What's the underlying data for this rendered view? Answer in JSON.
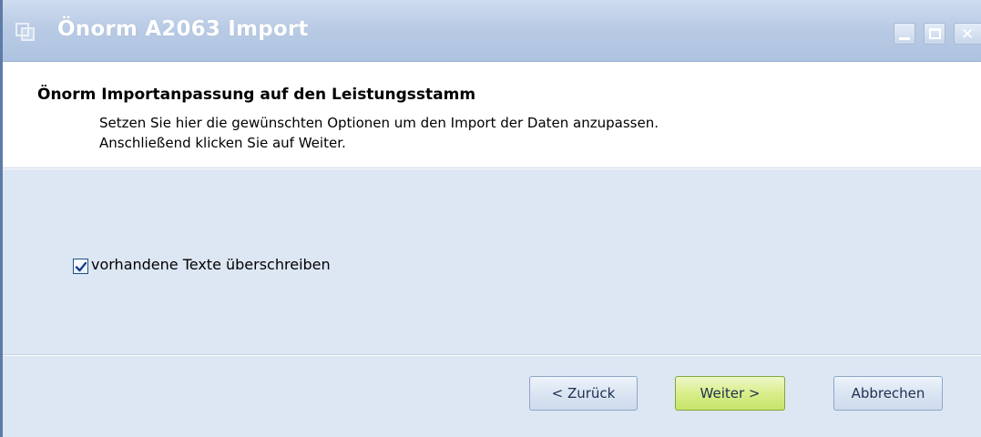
{
  "window": {
    "title": "Önorm A2063 Import"
  },
  "header": {
    "title": "Önorm Importanpassung auf den Leistungsstamm",
    "desc_line1": "Setzen Sie hier die gewünschten Optionen um den Import der Daten anzupassen.",
    "desc_line2": "Anschließend klicken Sie auf Weiter."
  },
  "options": {
    "overwrite_label": "vorhandene Texte überschreiben",
    "overwrite_checked": true
  },
  "buttons": {
    "back": "< Zurück",
    "next": "Weiter >",
    "cancel": "Abbrechen"
  },
  "icons": {
    "app": "app-window-icon",
    "minimize": "minimize-icon",
    "maximize": "maximize-icon",
    "close": "close-icon",
    "check": "checkmark-icon"
  },
  "colors": {
    "titlebar": "#b9cbe5",
    "content_bg": "#dde7f4",
    "next_button": "#d9ee8a"
  }
}
